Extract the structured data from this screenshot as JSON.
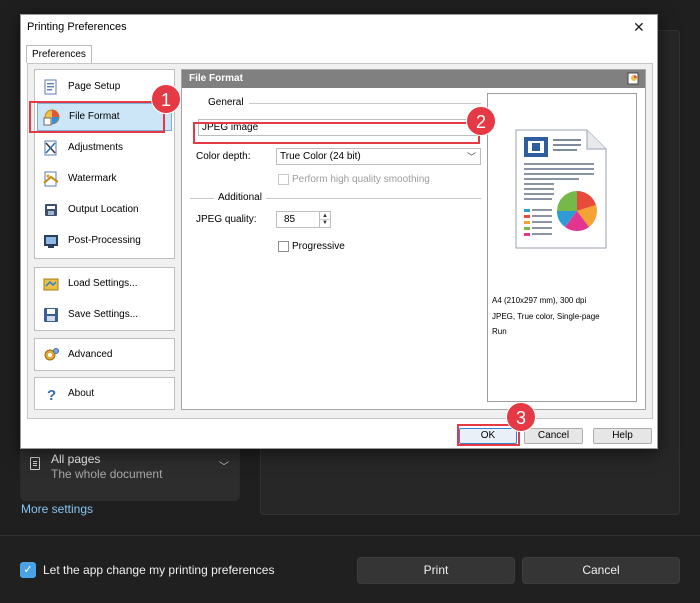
{
  "background_dialog": {
    "pages_title": "All pages",
    "pages_subtitle": "The whole document",
    "more_settings": "More settings",
    "let_app_change_label": "Let the app change my printing preferences",
    "let_app_change_checked": true,
    "print_button": "Print",
    "cancel_button": "Cancel"
  },
  "dialog": {
    "title": "Printing Preferences",
    "close_glyph": "✕",
    "tab": "Preferences"
  },
  "sidebar": {
    "group1": [
      {
        "label": "Page Setup",
        "icon": "page-setup-icon"
      },
      {
        "label": "File Format",
        "icon": "file-format-icon",
        "selected": true
      },
      {
        "label": "Adjustments",
        "icon": "adjustments-icon"
      },
      {
        "label": "Watermark",
        "icon": "watermark-icon"
      },
      {
        "label": "Output Location",
        "icon": "output-location-icon"
      },
      {
        "label": "Post-Processing",
        "icon": "post-processing-icon"
      }
    ],
    "group2": [
      {
        "label": "Load Settings...",
        "icon": "load-settings-icon"
      },
      {
        "label": "Save Settings...",
        "icon": "save-settings-icon"
      }
    ],
    "group3": [
      {
        "label": "Advanced",
        "icon": "advanced-icon"
      }
    ],
    "group4": [
      {
        "label": "About",
        "icon": "help-icon"
      }
    ]
  },
  "panel": {
    "header": "File Format",
    "general_label": "General",
    "file_format_value": "JPEG image",
    "color_depth_label": "Color depth:",
    "color_depth_value": "True Color (24 bit)",
    "smoothing_label": "Perform high quality smoothing",
    "smoothing_checked": false,
    "additional_label": "Additional",
    "jpeg_quality_label": "JPEG quality:",
    "jpeg_quality_value": "85",
    "progressive_label": "Progressive",
    "progressive_checked": false
  },
  "preview": {
    "line1": "A4 (210x297 mm), 300 dpi",
    "line2": "JPEG, True color, Single-page",
    "line3": "Run"
  },
  "buttons": {
    "ok": "OK",
    "cancel": "Cancel",
    "help": "Help"
  },
  "annotations": {
    "step1": "1",
    "step2": "2",
    "step3": "3",
    "color": "#e53a45"
  },
  "colors": {
    "accent_blue": "#4aa3e6",
    "selection_bg": "#cde6f7",
    "panel_header": "#808080",
    "link": "#86c5f5"
  }
}
